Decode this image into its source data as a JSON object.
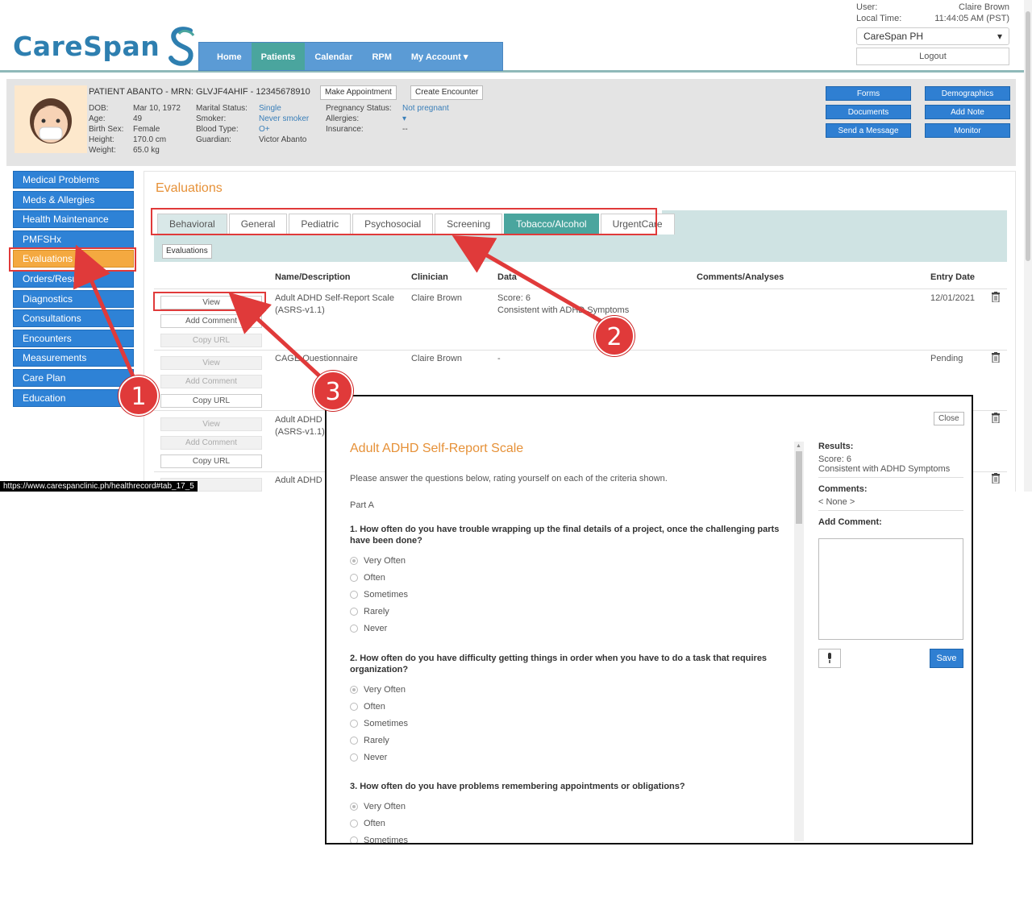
{
  "brand": {
    "name": "CareSpan",
    "accent": "#2e7fb0"
  },
  "nav": {
    "items": [
      {
        "label": "Home"
      },
      {
        "label": "Patients"
      },
      {
        "label": "Calendar"
      },
      {
        "label": "RPM"
      },
      {
        "label": "My Account ▾"
      }
    ],
    "active": "Patients"
  },
  "user": {
    "user_label": "User:",
    "user_value": "Claire Brown",
    "time_label": "Local Time:",
    "time_value": "11:44:05 AM (PST)",
    "clinic": "CareSpan PH",
    "logout": "Logout"
  },
  "patient": {
    "title": "PATIENT ABANTO - MRN: GLVJF4AHIF - 12345678910",
    "make_appointment": "Make Appointment",
    "create_encounter": "Create Encounter",
    "col1": {
      "dob_l": "DOB:",
      "dob": "Mar 10, 1972",
      "age_l": "Age:",
      "age": "49",
      "sex_l": "Birth Sex:",
      "sex": "Female",
      "height_l": "Height:",
      "height": "170.0 cm",
      "weight_l": "Weight:",
      "weight": "65.0 kg"
    },
    "col2": {
      "marital_l": "Marital Status:",
      "marital": "Single",
      "smoker_l": "Smoker:",
      "smoker": "Never smoker",
      "blood_l": "Blood Type:",
      "blood": "O+",
      "guardian_l": "Guardian:",
      "guardian": "Victor Abanto"
    },
    "col3": {
      "preg_l": "Pregnancy Status:",
      "preg": "Not pregnant",
      "allergies_l": "Allergies:",
      "insurance_l": "Insurance:",
      "insurance": "--"
    },
    "actions": [
      "Forms",
      "Demographics",
      "Documents",
      "Add Note",
      "Send a Message",
      "Monitor"
    ]
  },
  "sidebar": {
    "items": [
      "Medical Problems",
      "Meds & Allergies",
      "Health Maintenance",
      "PMFSHx",
      "Evaluations",
      "Orders/Results",
      "Diagnostics",
      "Consultations",
      "Encounters",
      "Measurements",
      "Care Plan",
      "Education"
    ],
    "active_index": 4
  },
  "evaluations": {
    "title": "Evaluations",
    "tabs": [
      "Behavioral",
      "General",
      "Pediatric",
      "Psychosocial",
      "Screening",
      "Tobacco/Alcohol",
      "UrgentCare"
    ],
    "active_tab": "Tobacco/Alcohol",
    "sub_button": "Evaluations",
    "columns": [
      "Name/Description",
      "Clinician",
      "Data",
      "Comments/Analyses",
      "Entry Date"
    ],
    "rows": [
      {
        "view": "View",
        "add_comment": "Add Comment",
        "copy_url": "Copy URL",
        "name": "Adult ADHD Self-Report Scale",
        "name2": "(ASRS-v1.1)",
        "clinician": "Claire Brown",
        "data": "Score: 6",
        "data2": "Consistent with ADHD Symptoms",
        "date": "12/01/2021"
      },
      {
        "view": "View",
        "add_comment": "Add Comment",
        "copy_url": "Copy URL",
        "name": "CAGE Questionnaire",
        "name2": "",
        "clinician": "Claire Brown",
        "data": "-",
        "data2": "",
        "date": "Pending"
      },
      {
        "view": "View",
        "add_comment": "Add Comment",
        "copy_url": "Copy URL",
        "name": "Adult ADHD",
        "name2": "(ASRS-v1.1)",
        "clinician": "",
        "data": "",
        "data2": "",
        "date": ""
      },
      {
        "view": "",
        "add_comment": "",
        "copy_url": "",
        "name": "Adult ADHD",
        "name2": "",
        "clinician": "",
        "data": "",
        "data2": "",
        "date": ""
      }
    ]
  },
  "status_url": "https://www.carespanclinic.ph/healthrecord#tab_17_5",
  "modal": {
    "close": "Close",
    "title": "Adult ADHD Self-Report Scale",
    "instructions": "Please answer the questions below, rating yourself on each of the criteria shown.",
    "part": "Part A",
    "questions": [
      {
        "text": "1. How often do you have trouble wrapping up the final details of a project, once the challenging parts have been done?"
      },
      {
        "text": "2. How often do you have difficulty getting things in order when you have to do a task that requires organization?"
      },
      {
        "text": "3. How often do you have problems remembering appointments or obligations?"
      }
    ],
    "options": [
      "Very Often",
      "Often",
      "Sometimes",
      "Rarely",
      "Never"
    ],
    "results_label": "Results:",
    "results_score": "Score: 6",
    "results_text": "Consistent with ADHD Symptoms",
    "comments_label": "Comments:",
    "comments_value": "< None >",
    "add_comment_label": "Add Comment:",
    "save": "Save"
  },
  "annotations": {
    "badge1": "1",
    "badge2": "2",
    "badge3": "3",
    "color": "#e03a3a"
  }
}
